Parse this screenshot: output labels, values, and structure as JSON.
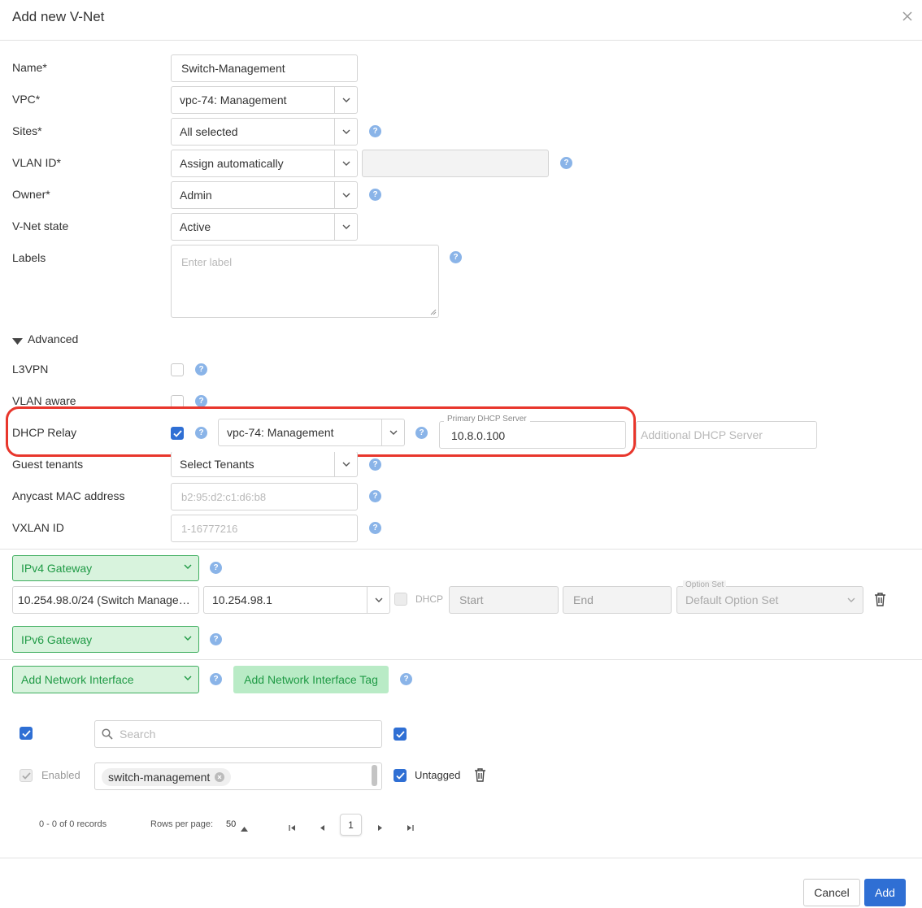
{
  "dialog": {
    "title": "Add new V-Net"
  },
  "fields": {
    "name": {
      "label": "Name*",
      "value": "Switch-Management"
    },
    "vpc": {
      "label": "VPC*",
      "value": "vpc-74: Management"
    },
    "sites": {
      "label": "Sites*",
      "value": "All selected"
    },
    "vlan_id": {
      "label": "VLAN ID*",
      "value": "Assign automatically",
      "extra_value": ""
    },
    "owner": {
      "label": "Owner*",
      "value": "Admin"
    },
    "vnet_state": {
      "label": "V-Net state",
      "value": "Active"
    },
    "labels": {
      "label": "Labels",
      "placeholder": "Enter label"
    }
  },
  "advanced": {
    "toggle_label": "Advanced",
    "l3vpn": {
      "label": "L3VPN",
      "checked": false
    },
    "vlan_aware": {
      "label": "VLAN aware",
      "checked": false
    },
    "dhcp_relay": {
      "label": "DHCP Relay",
      "checked": true,
      "vpc_value": "vpc-74: Management",
      "primary_label": "Primary DHCP Server",
      "primary_value": "10.8.0.100",
      "additional_placeholder": "Additional DHCP Server"
    },
    "guest_tenants": {
      "label": "Guest tenants",
      "value": "Select Tenants"
    },
    "anycast_mac": {
      "label": "Anycast MAC address",
      "placeholder": "b2:95:d2:c1:d6:b8"
    },
    "vxlan_id": {
      "label": "VXLAN ID",
      "placeholder": "1-16777216"
    }
  },
  "ipv4": {
    "button": "IPv4 Gateway",
    "subnet": "10.254.98.0/24 (Switch Manage…",
    "gateway": "10.254.98.1",
    "dhcp_label": "DHCP",
    "start_placeholder": "Start",
    "end_placeholder": "End",
    "option_set_label": "Option Set",
    "option_set_value": "Default Option Set"
  },
  "ipv6": {
    "button": "IPv6 Gateway"
  },
  "network_interface": {
    "add_button": "Add Network Interface",
    "add_tag_button": "Add Network Interface Tag",
    "search_placeholder": "Search",
    "row": {
      "enabled_label": "Enabled",
      "tag": "switch-management",
      "untagged_label": "Untagged"
    }
  },
  "pagination": {
    "records": "0 - 0 of 0 records",
    "rows_per_page_label": "Rows per page:",
    "rows_per_page": "50",
    "page": "1"
  },
  "footer": {
    "cancel": "Cancel",
    "add": "Add"
  },
  "colors": {
    "accent": "#2f6fd4",
    "green": "#1f9a45",
    "highlight": "#e8362c",
    "help": "#8ab4e8"
  }
}
